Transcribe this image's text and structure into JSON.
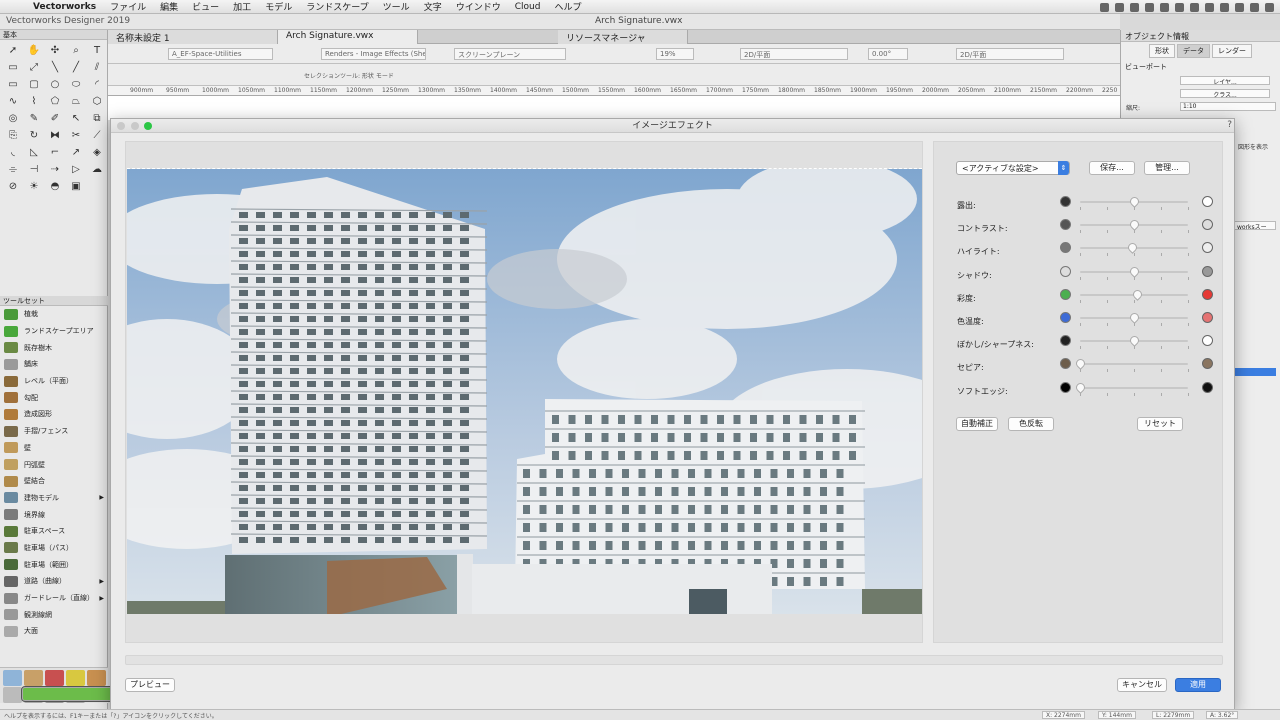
{
  "menubar": {
    "app": "Vectorworks",
    "items": [
      "ファイル",
      "編集",
      "ビュー",
      "加工",
      "モデル",
      "ランドスケープ",
      "ツール",
      "文字",
      "ウインドウ",
      "Cloud",
      "ヘルプ"
    ]
  },
  "window": {
    "app_title": "Vectorworks Designer 2019",
    "doc_title": "Arch Signature.vwx"
  },
  "doc_tabs": [
    "名称未設定 1",
    "Arch Signature.vwx",
    "リソースマネージャ"
  ],
  "view_bar": {
    "class_select": "A_EF-Space-Utilities",
    "render_select": "Renders - Image Effects (Sheet...",
    "plane_select": "スクリーンプレーン",
    "zoom": "19%",
    "view_select": "2D/平面",
    "angle": "0.00°",
    "view_select2": "2D/平面"
  },
  "mode_bar": {
    "label": "セレクションツール: 形状 モード"
  },
  "ruler_ticks": [
    "900mm",
    "950mm",
    "1000mm",
    "1050mm",
    "1100mm",
    "1150mm",
    "1200mm",
    "1250mm",
    "1300mm",
    "1350mm",
    "1400mm",
    "1450mm",
    "1500mm",
    "1550mm",
    "1600mm",
    "1650mm",
    "1700mm",
    "1750mm",
    "1800mm",
    "1850mm",
    "1900mm",
    "1950mm",
    "2000mm",
    "2050mm",
    "2100mm",
    "2150mm",
    "2200mm",
    "2250"
  ],
  "left_palette": {
    "title": "基本",
    "toolsets_title": "ツールセット",
    "toolsets": [
      {
        "label": "植栽",
        "color": "#4a9a3a",
        "arrow": ""
      },
      {
        "label": "ランドスケープエリア",
        "color": "#49a83b",
        "arrow": ""
      },
      {
        "label": "既存樹木",
        "color": "#6a8a44",
        "arrow": ""
      },
      {
        "label": "舗床",
        "color": "#9a9a9a",
        "arrow": ""
      },
      {
        "label": "レベル（平面）",
        "color": "#8a6a3a",
        "arrow": ""
      },
      {
        "label": "勾配",
        "color": "#a0703a",
        "arrow": ""
      },
      {
        "label": "造成図形",
        "color": "#b07a3a",
        "arrow": ""
      },
      {
        "label": "手摺/フェンス",
        "color": "#7a6a4a",
        "arrow": ""
      },
      {
        "label": "壁",
        "color": "#c09a5a",
        "arrow": ""
      },
      {
        "label": "円弧壁",
        "color": "#c0a060",
        "arrow": ""
      },
      {
        "label": "壁結合",
        "color": "#b08a4a",
        "arrow": ""
      },
      {
        "label": "建物モデル",
        "color": "#6a8aa0",
        "arrow": "▶"
      },
      {
        "label": "境界線",
        "color": "#7a7a7a",
        "arrow": ""
      },
      {
        "label": "駐車スペース",
        "color": "#5a7a3a",
        "arrow": ""
      },
      {
        "label": "駐車場（パス）",
        "color": "#6a7a4a",
        "arrow": ""
      },
      {
        "label": "駐車場（範囲）",
        "color": "#4a6a3a",
        "arrow": ""
      },
      {
        "label": "道路（曲線）",
        "color": "#666",
        "arrow": "▶"
      },
      {
        "label": "ガードレール（直線）",
        "color": "#888",
        "arrow": "▶"
      },
      {
        "label": "観測線網",
        "color": "#999",
        "arrow": ""
      },
      {
        "label": "大面",
        "color": "#aaa",
        "arrow": ""
      }
    ]
  },
  "obj_info": {
    "title": "オブジェクト情報",
    "tabs": [
      "形状",
      "データ",
      "レンダー"
    ],
    "section": "ビューポート",
    "layer_label": "レイヤ...",
    "class_label": "クラス...",
    "scale_label": "縮尺:",
    "scale_value": "1:10",
    "show_label": "図形を表示",
    "worksite_value": "worksスー"
  },
  "dialog": {
    "title": "イメージエフェクト",
    "preset_select": "<アクティブな設定>",
    "save_button": "保存...",
    "manage_button": "管理...",
    "sliders": [
      {
        "label": "露出:",
        "value": 0.5
      },
      {
        "label": "コントラスト:",
        "value": 0.5
      },
      {
        "label": "ハイライト:",
        "value": 0.48
      },
      {
        "label": "シャドウ:",
        "value": 0.5
      },
      {
        "label": "彩度:",
        "value": 0.53
      },
      {
        "label": "色温度:",
        "value": 0.5
      },
      {
        "label": "ぼかし/シャープネス:",
        "value": 0.5
      },
      {
        "label": "セピア:",
        "value": 0.0
      },
      {
        "label": "ソフトエッジ:",
        "value": 0.0
      }
    ],
    "auto_correct_button": "自動補正",
    "invert_button": "色反転",
    "reset_button": "リセット",
    "preview_button": "プレビュー",
    "cancel_button": "キャンセル",
    "apply_button": "適用"
  },
  "status": {
    "hint": "ヘルプを表示するには、F1キーまたは「?」アイコンをクリックしてください。",
    "x": "X: 2274mm",
    "y": "Y: 144mm",
    "l": "L: 2279mm",
    "a": "A: 3.62°"
  }
}
